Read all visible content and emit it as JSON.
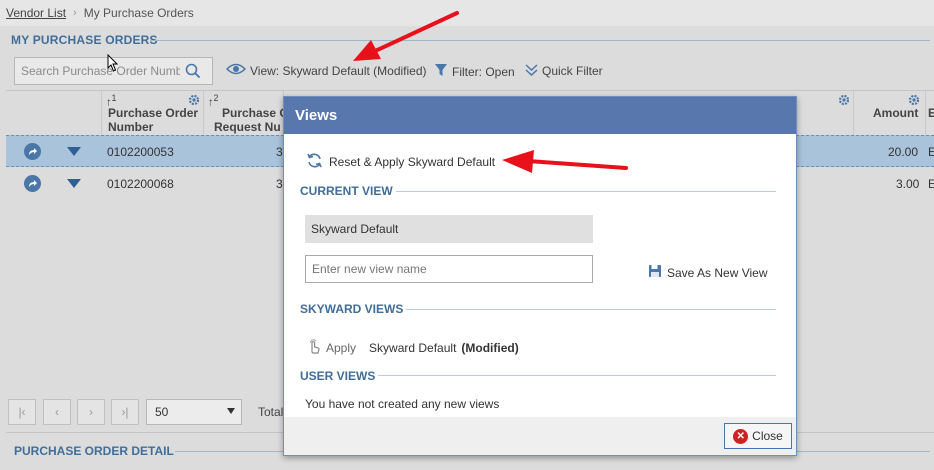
{
  "breadcrumb": {
    "link": "Vendor List",
    "current": "My Purchase Orders"
  },
  "section_title": "MY PURCHASE ORDERS",
  "search": {
    "placeholder": "Search Purchase Order Number"
  },
  "toolbar": {
    "view_label": "View: Skyward Default (Modified)",
    "filter_label": "Filter: Open",
    "quick_filter_label": "Quick Filter"
  },
  "columns": [
    {
      "sort": "1",
      "label1": "Purchase Order",
      "label2": "Number"
    },
    {
      "sort": "2",
      "label1": "Purchase O",
      "label2": "Request Nu"
    },
    {
      "label": "Amount"
    },
    {
      "label": "E"
    }
  ],
  "rows": [
    {
      "po_number": "0102200053",
      "req_partial": "3",
      "amount": "20.00",
      "extra": "E"
    },
    {
      "po_number": "0102200068",
      "req_partial": "3",
      "amount": "3.00",
      "extra": "E"
    }
  ],
  "pager": {
    "page_size": "50",
    "total_label": "Total"
  },
  "detail_title": "PURCHASE ORDER DETAIL",
  "modal": {
    "title": "Views",
    "reset_label": "Reset & Apply Skyward Default",
    "current_view_title": "CURRENT VIEW",
    "current_view_name": "Skyward Default",
    "new_view_placeholder": "Enter new view name",
    "save_label": "Save As New View",
    "skyward_views_title": "SKYWARD VIEWS",
    "apply_label": "Apply",
    "skyward_view_name": "Skyward Default",
    "skyward_view_modified": "(Modified)",
    "user_views_title": "USER VIEWS",
    "no_views_text": "You have not created any new views",
    "close_label": "Close"
  },
  "colors": {
    "accent": "#3f6e9a",
    "modal_header": "#5877ad",
    "selected_row": "#a9c3db",
    "annotation_arrow": "#e8101a"
  }
}
